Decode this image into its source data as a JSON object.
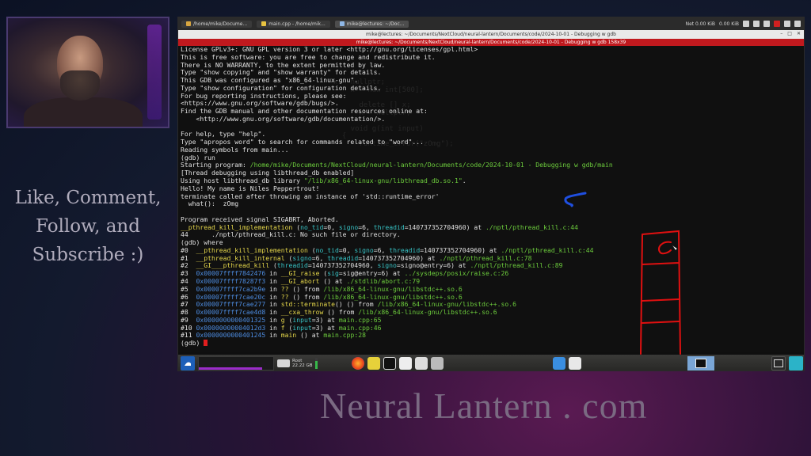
{
  "promo": {
    "line1": "Like, Comment,",
    "line2": "Follow, and",
    "line3": "Subscribe :)"
  },
  "brand": "Neural Lantern . com",
  "panel": {
    "tasks": [
      "/home/mike/Docume...",
      "main.cpp - /home/mik...",
      "mike@lectures: ~/Doc..."
    ],
    "net": "Net 0.00 KiB",
    "net2": "0.00 KiB"
  },
  "window": {
    "title": "mike@lectures: ~/Documents/NextCloud/neural-lantern/Documents/code/2024-10-01 - Debugging w gdb",
    "tab": "mike@lectures: ~/Documents/NextCloud/neural-lantern/Documents/code/2024-10-01 - Debugging w gdb 158x39"
  },
  "terminal": {
    "lines": [
      "License GPLv3+: GNU GPL version 3 or later <http://gnu.org/licenses/gpl.html>",
      "This is free software: you are free to change and redistribute it.",
      "There is NO WARRANTY, to the extent permitted by law.",
      "Type \"show copying\" and \"show warranty\" for details.",
      "This GDB was configured as \"x86_64-linux-gnu\".",
      "Type \"show configuration\" for configuration details.",
      "For bug reporting instructions, please see:",
      "<https://www.gnu.org/software/gdb/bugs/>.",
      "Find the GDB manual and other documentation resources online at:",
      "    <http://www.gnu.org/software/gdb/documentation/>.",
      "",
      "For help, type \"help\".",
      "Type \"apropos word\" to search for commands related to \"word\"...",
      "Reading symbols from main...",
      "(gdb) run",
      "Starting program: /home/mike/Documents/NextCloud/neural-lantern/Documents/code/2024-10-01 - Debugging w gdb/main",
      "[Thread debugging using libthread_db enabled]",
      "Using host libthread_db library \"/lib/x86_64-linux-gnu/libthread_db.so.1\".",
      "Hello! My name is Niles Peppertrout!",
      "terminate called after throwing an instance of 'std::runtime_error'",
      "  what():  zOmg",
      "",
      "Program received signal SIGABRT, Aborted.",
      "__pthread_kill_implementation (no_tid=0, signo=6, threadid=140737352704960) at ./nptl/pthread_kill.c:44",
      "44\t./nptl/pthread_kill.c: No such file or directory.",
      "(gdb) where",
      "#0  __pthread_kill_implementation (no_tid=0, signo=6, threadid=140737352704960) at ./nptl/pthread_kill.c:44",
      "#1  __pthread_kill_internal (signo=6, threadid=140737352704960) at ./nptl/pthread_kill.c:78",
      "#2  __GI___pthread_kill (threadid=140737352704960, signo=signo@entry=6) at ./nptl/pthread_kill.c:89",
      "#3  0x00007ffff7842476 in __GI_raise (sig=sig@entry=6) at ../sysdeps/posix/raise.c:26",
      "#4  0x00007ffff78287f3 in __GI_abort () at ./stdlib/abort.c:79",
      "#5  0x00007ffff7ca2b9e in ?? () from /lib/x86_64-linux-gnu/libstdc++.so.6",
      "#6  0x00007ffff7cae20c in ?? () from /lib/x86_64-linux-gnu/libstdc++.so.6",
      "#7  0x00007ffff7cae277 in std::terminate() () from /lib/x86_64-linux-gnu/libstdc++.so.6",
      "#8  0x00007ffff7cae4d8 in __cxa_throw () from /lib/x86_64-linux-gnu/libstdc++.so.6",
      "#9  0x0000000000401325 in g (input=3) at main.cpp:65",
      "#10 0x00000000004012d3 in f (input=3) at main.cpp:46",
      "#11 0x0000000000401245 in main () at main.cpp:28",
      "(gdb) "
    ]
  },
  "taskbar": {
    "disk_label": "Root",
    "disk_size": "22.22 GB",
    "graph_fill": 0.85,
    "disk_fill": 0.7
  },
  "colors": {
    "terminal_bg": "#101010",
    "tab_red": "#c0191e",
    "drawing_red": "#e01010",
    "drawing_blue": "#1f4fe0",
    "func_yellow": "#e4d64a",
    "arg_cyan": "#37c2c4",
    "file_green": "#6ccb3c",
    "addr_blue": "#4d8ce0"
  }
}
